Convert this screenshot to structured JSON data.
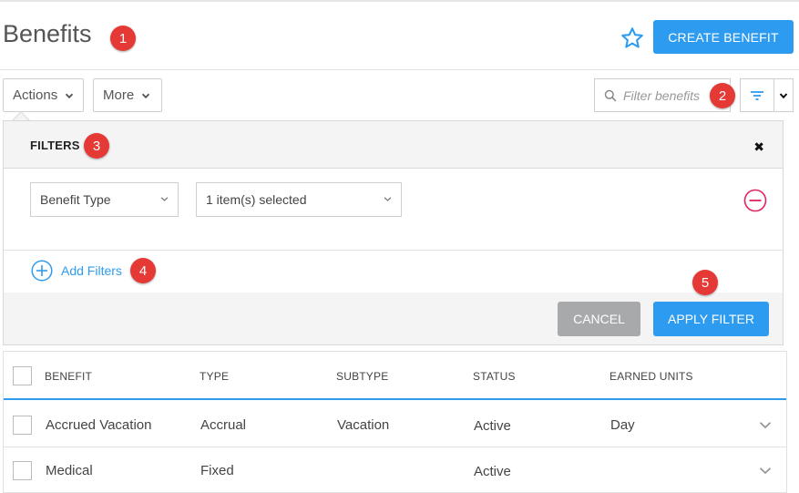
{
  "header": {
    "title": "Benefits",
    "create_label": "CREATE BENEFIT"
  },
  "callouts": [
    "1",
    "2",
    "3",
    "4",
    "5"
  ],
  "toolbar": {
    "actions_label": "Actions",
    "more_label": "More",
    "search_placeholder": "Filter benefits"
  },
  "filters_panel": {
    "title": "FILTERS",
    "close_glyph": "✖",
    "field_select": "Benefit Type",
    "value_select": "1 item(s) selected",
    "add_filters_label": "Add Filters",
    "cancel_label": "CANCEL",
    "apply_label": "APPLY FILTER"
  },
  "table": {
    "columns": [
      "BENEFIT",
      "TYPE",
      "SUBTYPE",
      "STATUS",
      "EARNED UNITS"
    ],
    "rows": [
      {
        "benefit": "Accrued Vacation",
        "type": "Accrual",
        "subtype": "Vacation",
        "status": "Active",
        "earned_units": "Day"
      },
      {
        "benefit": "Medical",
        "type": "Fixed",
        "subtype": "",
        "status": "Active",
        "earned_units": ""
      }
    ]
  },
  "colors": {
    "accent": "#2d9cf0",
    "callout": "#e53935",
    "remove": "#e0245e",
    "cancel": "#a7a9ab"
  },
  "icons": [
    "star-icon",
    "search-icon",
    "filter-icon",
    "chevron-down-icon",
    "close-icon",
    "remove-circle-icon",
    "add-circle-icon"
  ]
}
